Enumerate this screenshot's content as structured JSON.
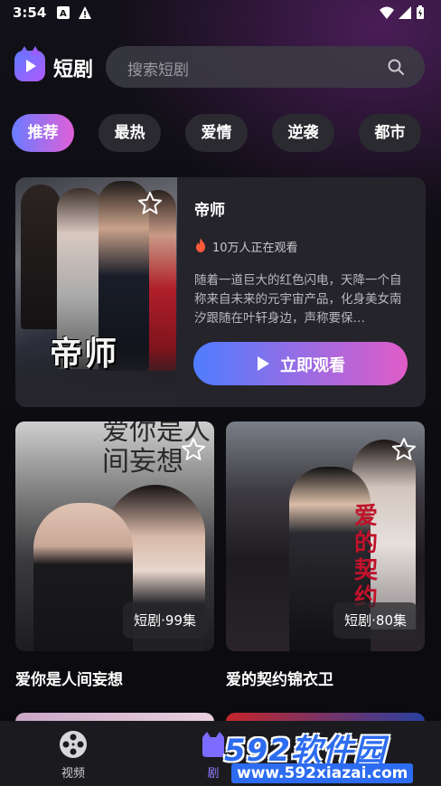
{
  "status_bar": {
    "time": "3:54"
  },
  "header": {
    "app_title": "短剧",
    "search_placeholder": "搜索短剧"
  },
  "tabs": [
    {
      "label": "推荐",
      "active": true
    },
    {
      "label": "最热",
      "active": false
    },
    {
      "label": "爱情",
      "active": false
    },
    {
      "label": "逆袭",
      "active": false
    },
    {
      "label": "都市",
      "active": false
    }
  ],
  "featured": {
    "poster_title": "帝师",
    "title": "帝师",
    "watching": "10万人正在观看",
    "description": "随着一道巨大的红色闪电，天降一个自称来自未来的元宇宙产品，化身美女南汐跟随在叶轩身边，声称要保…",
    "watch_button": "立即观看"
  },
  "cards": [
    {
      "poster_text": "爱你是人间妄想",
      "badge": "短剧·99集",
      "title": "爱你是人间妄想"
    },
    {
      "poster_text": "爱的契约",
      "badge": "短剧·80集",
      "title": "爱的契约锦衣卫"
    }
  ],
  "nav": [
    {
      "label": "视频",
      "icon": "film-reel-icon"
    },
    {
      "label": "剧",
      "icon": "cat-logo-icon"
    }
  ],
  "watermark": {
    "big": "592软件园",
    "small": "www.592xiazai.com"
  },
  "colors": {
    "accent_start": "#6a7cff",
    "accent_end": "#e060d8",
    "button_start": "#4f7dff",
    "button_end": "#e05cc8"
  }
}
